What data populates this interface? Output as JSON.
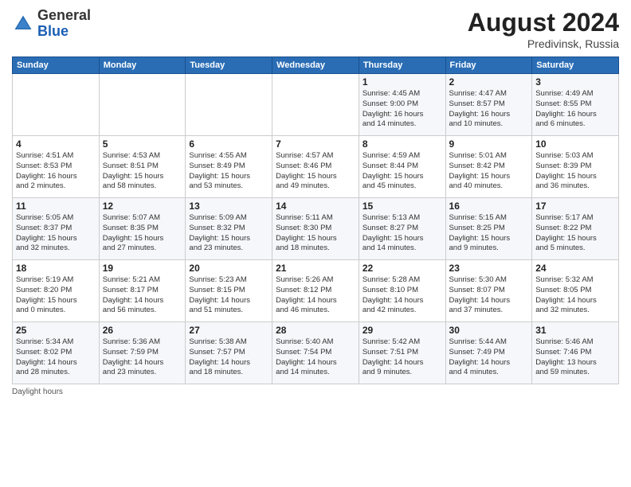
{
  "header": {
    "logo_general": "General",
    "logo_blue": "Blue",
    "month_year": "August 2024",
    "location": "Predivinsk, Russia"
  },
  "days_of_week": [
    "Sunday",
    "Monday",
    "Tuesday",
    "Wednesday",
    "Thursday",
    "Friday",
    "Saturday"
  ],
  "weeks": [
    [
      {
        "day": "",
        "info": ""
      },
      {
        "day": "",
        "info": ""
      },
      {
        "day": "",
        "info": ""
      },
      {
        "day": "",
        "info": ""
      },
      {
        "day": "1",
        "info": "Sunrise: 4:45 AM\nSunset: 9:00 PM\nDaylight: 16 hours\nand 14 minutes."
      },
      {
        "day": "2",
        "info": "Sunrise: 4:47 AM\nSunset: 8:57 PM\nDaylight: 16 hours\nand 10 minutes."
      },
      {
        "day": "3",
        "info": "Sunrise: 4:49 AM\nSunset: 8:55 PM\nDaylight: 16 hours\nand 6 minutes."
      }
    ],
    [
      {
        "day": "4",
        "info": "Sunrise: 4:51 AM\nSunset: 8:53 PM\nDaylight: 16 hours\nand 2 minutes."
      },
      {
        "day": "5",
        "info": "Sunrise: 4:53 AM\nSunset: 8:51 PM\nDaylight: 15 hours\nand 58 minutes."
      },
      {
        "day": "6",
        "info": "Sunrise: 4:55 AM\nSunset: 8:49 PM\nDaylight: 15 hours\nand 53 minutes."
      },
      {
        "day": "7",
        "info": "Sunrise: 4:57 AM\nSunset: 8:46 PM\nDaylight: 15 hours\nand 49 minutes."
      },
      {
        "day": "8",
        "info": "Sunrise: 4:59 AM\nSunset: 8:44 PM\nDaylight: 15 hours\nand 45 minutes."
      },
      {
        "day": "9",
        "info": "Sunrise: 5:01 AM\nSunset: 8:42 PM\nDaylight: 15 hours\nand 40 minutes."
      },
      {
        "day": "10",
        "info": "Sunrise: 5:03 AM\nSunset: 8:39 PM\nDaylight: 15 hours\nand 36 minutes."
      }
    ],
    [
      {
        "day": "11",
        "info": "Sunrise: 5:05 AM\nSunset: 8:37 PM\nDaylight: 15 hours\nand 32 minutes."
      },
      {
        "day": "12",
        "info": "Sunrise: 5:07 AM\nSunset: 8:35 PM\nDaylight: 15 hours\nand 27 minutes."
      },
      {
        "day": "13",
        "info": "Sunrise: 5:09 AM\nSunset: 8:32 PM\nDaylight: 15 hours\nand 23 minutes."
      },
      {
        "day": "14",
        "info": "Sunrise: 5:11 AM\nSunset: 8:30 PM\nDaylight: 15 hours\nand 18 minutes."
      },
      {
        "day": "15",
        "info": "Sunrise: 5:13 AM\nSunset: 8:27 PM\nDaylight: 15 hours\nand 14 minutes."
      },
      {
        "day": "16",
        "info": "Sunrise: 5:15 AM\nSunset: 8:25 PM\nDaylight: 15 hours\nand 9 minutes."
      },
      {
        "day": "17",
        "info": "Sunrise: 5:17 AM\nSunset: 8:22 PM\nDaylight: 15 hours\nand 5 minutes."
      }
    ],
    [
      {
        "day": "18",
        "info": "Sunrise: 5:19 AM\nSunset: 8:20 PM\nDaylight: 15 hours\nand 0 minutes."
      },
      {
        "day": "19",
        "info": "Sunrise: 5:21 AM\nSunset: 8:17 PM\nDaylight: 14 hours\nand 56 minutes."
      },
      {
        "day": "20",
        "info": "Sunrise: 5:23 AM\nSunset: 8:15 PM\nDaylight: 14 hours\nand 51 minutes."
      },
      {
        "day": "21",
        "info": "Sunrise: 5:26 AM\nSunset: 8:12 PM\nDaylight: 14 hours\nand 46 minutes."
      },
      {
        "day": "22",
        "info": "Sunrise: 5:28 AM\nSunset: 8:10 PM\nDaylight: 14 hours\nand 42 minutes."
      },
      {
        "day": "23",
        "info": "Sunrise: 5:30 AM\nSunset: 8:07 PM\nDaylight: 14 hours\nand 37 minutes."
      },
      {
        "day": "24",
        "info": "Sunrise: 5:32 AM\nSunset: 8:05 PM\nDaylight: 14 hours\nand 32 minutes."
      }
    ],
    [
      {
        "day": "25",
        "info": "Sunrise: 5:34 AM\nSunset: 8:02 PM\nDaylight: 14 hours\nand 28 minutes."
      },
      {
        "day": "26",
        "info": "Sunrise: 5:36 AM\nSunset: 7:59 PM\nDaylight: 14 hours\nand 23 minutes."
      },
      {
        "day": "27",
        "info": "Sunrise: 5:38 AM\nSunset: 7:57 PM\nDaylight: 14 hours\nand 18 minutes."
      },
      {
        "day": "28",
        "info": "Sunrise: 5:40 AM\nSunset: 7:54 PM\nDaylight: 14 hours\nand 14 minutes."
      },
      {
        "day": "29",
        "info": "Sunrise: 5:42 AM\nSunset: 7:51 PM\nDaylight: 14 hours\nand 9 minutes."
      },
      {
        "day": "30",
        "info": "Sunrise: 5:44 AM\nSunset: 7:49 PM\nDaylight: 14 hours\nand 4 minutes."
      },
      {
        "day": "31",
        "info": "Sunrise: 5:46 AM\nSunset: 7:46 PM\nDaylight: 13 hours\nand 59 minutes."
      }
    ]
  ],
  "footer": {
    "note": "Daylight hours"
  }
}
